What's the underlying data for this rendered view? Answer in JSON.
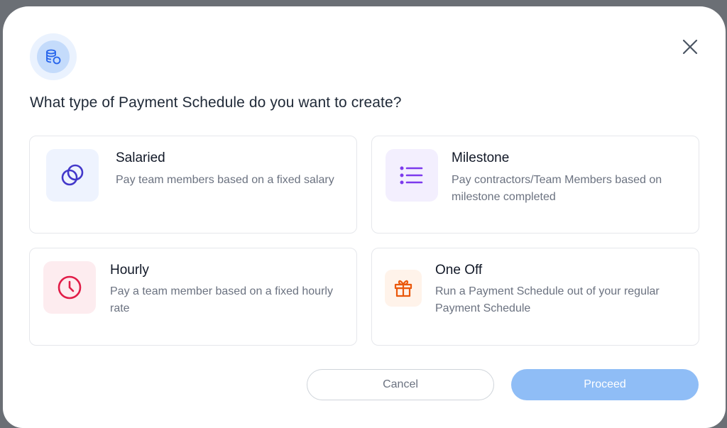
{
  "modal": {
    "title": "What type of Payment Schedule do you want to create?"
  },
  "options": [
    {
      "title": "Salaried",
      "description": "Pay team members based on a fixed salary",
      "icon": "coins-circles-icon",
      "color": "#4338ca",
      "bg": "#eef3fe"
    },
    {
      "title": "Milestone",
      "description": "Pay contractors/Team Members based on milestone completed",
      "icon": "list-icon",
      "color": "#7c3aed",
      "bg": "#f3effe"
    },
    {
      "title": "Hourly",
      "description": "Pay a team member based on a fixed hourly rate",
      "icon": "clock-icon",
      "color": "#e11d48",
      "bg": "#fdecef"
    },
    {
      "title": "One Off",
      "description": "Run a Payment Schedule out of your regular Payment Schedule",
      "icon": "gift-icon",
      "color": "#ea580c",
      "bg": "#fff3ea"
    }
  ],
  "buttons": {
    "cancel": "Cancel",
    "proceed": "Proceed"
  }
}
